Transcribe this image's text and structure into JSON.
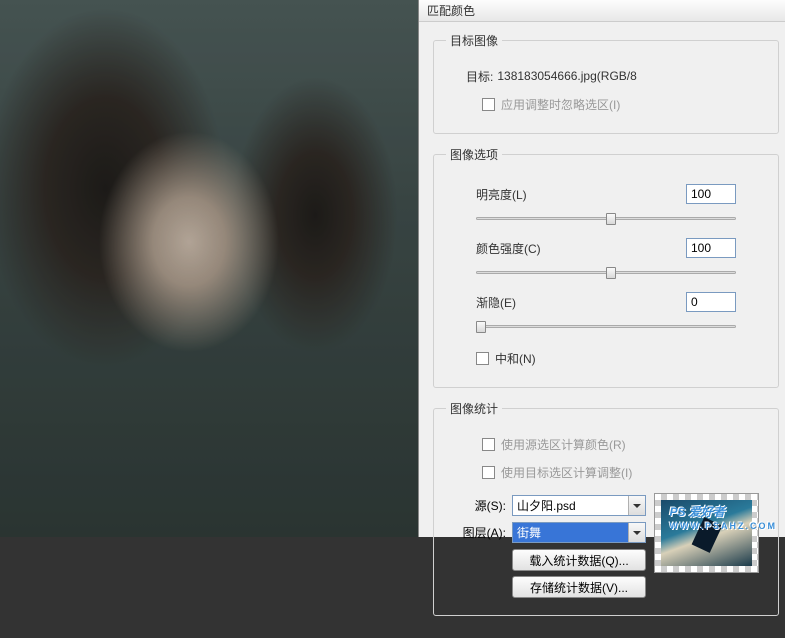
{
  "dialog": {
    "title": "匹配颜色",
    "target_image": {
      "legend": "目标图像",
      "target_label": "目标:",
      "target_value": "138183054666.jpg(RGB/8",
      "ignore_selection": "应用调整时忽略选区(I)"
    },
    "image_options": {
      "legend": "图像选项",
      "luminance": {
        "label": "明亮度(L)",
        "value": "100",
        "pos": 50
      },
      "color_intensity": {
        "label": "颜色强度(C)",
        "value": "100",
        "pos": 50
      },
      "fade": {
        "label": "渐隐(E)",
        "value": "0",
        "pos": 0
      },
      "neutralize": "中和(N)"
    },
    "image_stats": {
      "legend": "图像统计",
      "use_source_selection": "使用源选区计算颜色(R)",
      "use_target_selection": "使用目标选区计算调整(I)",
      "source_label": "源(S):",
      "source_value": "山夕阳.psd",
      "layer_label": "图层(A):",
      "layer_value": "街舞",
      "load_stats": "载入统计数据(Q)...",
      "save_stats": "存储统计数据(V)..."
    }
  },
  "watermark": {
    "main": "PS 爱好者",
    "sub": "WWW.PSAHZ.COM"
  }
}
